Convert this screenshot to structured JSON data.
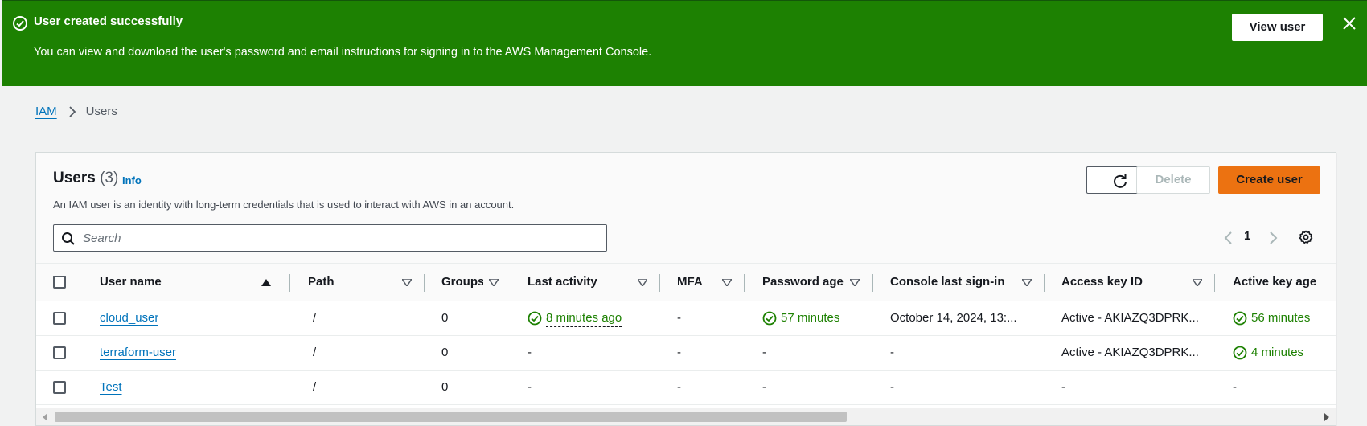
{
  "flash": {
    "title": "User created successfully",
    "message": "You can view and download the user's password and email instructions for signing in to the AWS Management Console.",
    "action_label": "View user",
    "color": "#1d8102"
  },
  "breadcrumb": {
    "root": "IAM",
    "current": "Users"
  },
  "panel": {
    "title": "Users",
    "count": "(3)",
    "info": "Info",
    "description": "An IAM user is an identity with long-term credentials that is used to interact with AWS in an account.",
    "refresh_icon": "refresh-icon",
    "delete_label": "Delete",
    "create_label": "Create user",
    "accent": "#ec7211"
  },
  "search": {
    "placeholder": "Search",
    "value": ""
  },
  "pagination": {
    "page": "1"
  },
  "table": {
    "columns": [
      {
        "label": "User name",
        "sort": "ascending"
      },
      {
        "label": "Path"
      },
      {
        "label": "Groups"
      },
      {
        "label": "Last activity"
      },
      {
        "label": "MFA"
      },
      {
        "label": "Password age"
      },
      {
        "label": "Console last sign-in"
      },
      {
        "label": "Access key ID"
      },
      {
        "label": "Active key age"
      }
    ],
    "rows": [
      {
        "user_name": "cloud_user",
        "path": "/",
        "groups": "0",
        "last_activity": "8 minutes ago",
        "mfa": "-",
        "password_age": "57 minutes",
        "console_last_sign_in": "October 14, 2024, 13:...",
        "access_key_id": "Active - AKIAZQ3DPRK...",
        "active_key_age": "56 minutes"
      },
      {
        "user_name": "terraform-user",
        "path": "/",
        "groups": "0",
        "last_activity": "-",
        "mfa": "-",
        "password_age": "-",
        "console_last_sign_in": "-",
        "access_key_id": "Active - AKIAZQ3DPRK...",
        "active_key_age": "4 minutes"
      },
      {
        "user_name": "Test",
        "path": "/",
        "groups": "0",
        "last_activity": "-",
        "mfa": "-",
        "password_age": "-",
        "console_last_sign_in": "-",
        "access_key_id": "-",
        "active_key_age": "-"
      }
    ]
  }
}
